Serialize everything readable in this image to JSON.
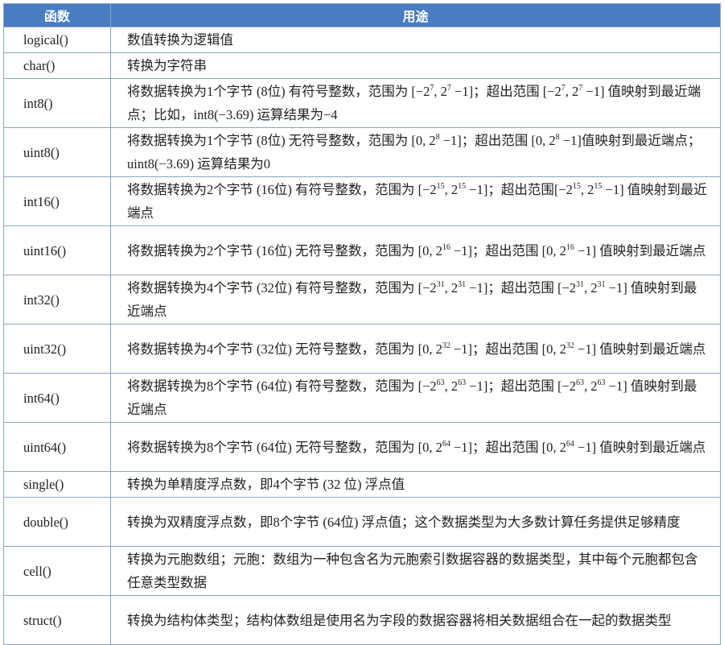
{
  "header": {
    "col1": "函数",
    "col2": "用途"
  },
  "rows": [
    {
      "fn": "logical()",
      "desc": [
        {
          "t": "数值转换为逻辑值"
        }
      ]
    },
    {
      "fn": "char()",
      "desc": [
        {
          "t": "转换为字符串"
        }
      ]
    },
    {
      "fn": "int8()",
      "desc": [
        {
          "t": "将数据转换为1个字节 (8位) 有符号整数，范围为 [−2"
        },
        {
          "sup": "7"
        },
        {
          "t": ", 2"
        },
        {
          "sup": "7"
        },
        {
          "t": " −1]；超出范围 [−2"
        },
        {
          "sup": "7"
        },
        {
          "t": ", 2"
        },
        {
          "sup": "7"
        },
        {
          "t": " −1] 值映射到最近端点；比如，int8(−3.69) 运算结果为−4"
        }
      ]
    },
    {
      "fn": "uint8()",
      "desc": [
        {
          "t": "将数据转换为1个字节 (8位) 无符号整数，范围为 [0, 2"
        },
        {
          "sup": "8"
        },
        {
          "t": " −1]；超出范围 [0, 2"
        },
        {
          "sup": "8"
        },
        {
          "t": " −1]值映射到最近端点；uint8(−3.69) 运算结果为0"
        }
      ]
    },
    {
      "fn": "int16()",
      "desc": [
        {
          "t": "将数据转换为2个字节 (16位) 有符号整数，范围为 [−2"
        },
        {
          "sup": "15"
        },
        {
          "t": ", 2"
        },
        {
          "sup": "15"
        },
        {
          "t": " −1]；超出范围[−2"
        },
        {
          "sup": "15"
        },
        {
          "t": ", 2"
        },
        {
          "sup": "15"
        },
        {
          "t": " −1] 值映射到最近端点"
        }
      ]
    },
    {
      "fn": "uint16()",
      "desc": [
        {
          "t": "将数据转换为2个字节 (16位) 无符号整数，范围为 [0, 2"
        },
        {
          "sup": "16"
        },
        {
          "t": " −1]；超出范围 [0, 2"
        },
        {
          "sup": "16"
        },
        {
          "t": " −1] 值映射到最近端点"
        }
      ]
    },
    {
      "fn": "int32()",
      "desc": [
        {
          "t": "将数据转换为4个字节 (32位) 有符号整数，范围为 [−2"
        },
        {
          "sup": "31"
        },
        {
          "t": ", 2"
        },
        {
          "sup": "31"
        },
        {
          "t": " −1]；超出范围 [−2"
        },
        {
          "sup": "31"
        },
        {
          "t": ", 2"
        },
        {
          "sup": "31"
        },
        {
          "t": " −1] 值映射到最近端点"
        }
      ]
    },
    {
      "fn": "uint32()",
      "desc": [
        {
          "t": "将数据转换为4个字节 (32位) 无符号整数，范围为 [0, 2"
        },
        {
          "sup": "32"
        },
        {
          "t": " −1]；超出范围 [0, 2"
        },
        {
          "sup": "32"
        },
        {
          "t": " −1] 值映射到最近端点"
        }
      ]
    },
    {
      "fn": "int64()",
      "desc": [
        {
          "t": "将数据转换为8个字节 (64位) 有符号整数，范围为 [−2"
        },
        {
          "sup": "63"
        },
        {
          "t": ", 2"
        },
        {
          "sup": "63"
        },
        {
          "t": " −1]；超出范围 [−2"
        },
        {
          "sup": "63"
        },
        {
          "t": ", 2"
        },
        {
          "sup": "63"
        },
        {
          "t": " −1] 值映射到最近端点"
        }
      ]
    },
    {
      "fn": "uint64()",
      "desc": [
        {
          "t": "将数据转换为8个字节 (64位) 无符号整数，范围为 [0, 2"
        },
        {
          "sup": "64"
        },
        {
          "t": " −1]；超出范围 [0, 2"
        },
        {
          "sup": "64"
        },
        {
          "t": " −1] 值映射到最近端点"
        }
      ]
    },
    {
      "fn": "single()",
      "desc": [
        {
          "t": "转换为单精度浮点数，即4个字节 (32 位) 浮点值"
        }
      ]
    },
    {
      "fn": "double()",
      "desc": [
        {
          "t": "转换为双精度浮点数，即8个字节 (64位) 浮点值；这个数据类型为大多数计算任务提供足够精度"
        }
      ]
    },
    {
      "fn": "cell()",
      "desc": [
        {
          "t": "转换为元胞数组；元胞：数组为一种包含名为元胞索引数据容器的数据类型，其中每个元胞都包含任意类型数据"
        }
      ]
    },
    {
      "fn": "struct()",
      "desc": [
        {
          "t": "转换为结构体类型；结构体数组是使用名为字段的数据容器将相关数据组合在一起的数据类型"
        }
      ]
    }
  ]
}
